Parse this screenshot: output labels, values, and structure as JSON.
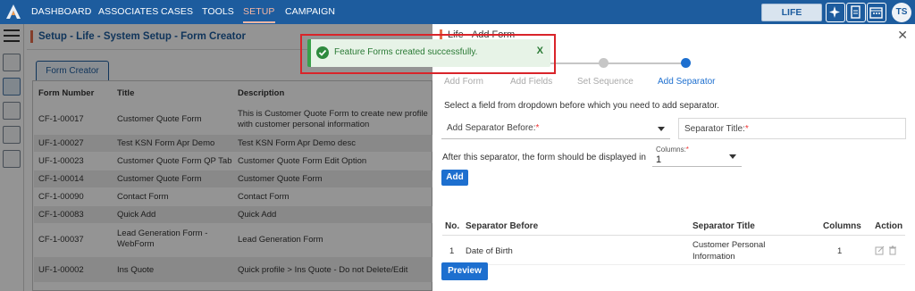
{
  "nav": {
    "items": [
      "DASHBOARD",
      "ASSOCIATES",
      "CASES",
      "TOOLS",
      "SETUP",
      "CAMPAIGN"
    ],
    "active": "SETUP",
    "line_label": "LIFE",
    "user_initials": "TS",
    "icons": [
      "sparkle-icon",
      "clipboard-icon",
      "calendar-icon"
    ]
  },
  "sidebar": {
    "icons": [
      "contact-card-icon",
      "contact-book-icon",
      "person-icon",
      "printer-icon",
      "form-icon"
    ]
  },
  "page": {
    "header": "Setup - Life - System Setup - Form Creator",
    "tab": "Form Creator",
    "columns": [
      "Form Number",
      "Title",
      "Description"
    ],
    "rows": [
      {
        "num": "CF-1-00017",
        "title": "Customer Quote Form",
        "desc": "This is Customer Quote Form to create new profile",
        "desc2": "with customer personal information"
      },
      {
        "num": "UF-1-00027",
        "title": "Test KSN Form Apr Demo",
        "desc": "Test KSN Form Apr Demo desc",
        "desc2": ""
      },
      {
        "num": "UF-1-00023",
        "title": "Customer Quote Form QP Tab",
        "desc": "Customer Quote Form Edit Option",
        "desc2": ""
      },
      {
        "num": "CF-1-00014",
        "title": "Customer Quote Form",
        "desc": "Customer Quote Form",
        "desc2": ""
      },
      {
        "num": "CF-1-00090",
        "title": "Contact Form",
        "desc": "Contact Form",
        "desc2": ""
      },
      {
        "num": "CF-1-00083",
        "title": "Quick Add",
        "desc": "Quick Add",
        "desc2": ""
      },
      {
        "num": "CF-1-00037",
        "title": "Lead Generation Form -",
        "title2": "WebForm",
        "desc": "Lead Generation Form",
        "desc2": ""
      },
      {
        "num": "UF-1-00002",
        "title": "Ins Quote",
        "desc": "Quick profile > Ins Quote - Do not Delete/Edit",
        "desc2": ""
      }
    ]
  },
  "modal": {
    "title": "Life - Add Form",
    "steps": [
      "Add Form",
      "Add Fields",
      "Set Sequence",
      "Add Separator"
    ],
    "active_step": 3,
    "instruction": "Select a field from dropdown before which you need to add separator.",
    "separator_before_label": "Add Separator Before:",
    "separator_title_label": "Separator Title:",
    "required_mark": "*",
    "after_text": "After this separator, the form should be displayed in",
    "columns_label": "Columns:",
    "columns_value": "1",
    "add_button": "Add",
    "table_headers": [
      "No.",
      "Separator Before",
      "Separator Title",
      "Columns",
      "Action"
    ],
    "table_rows": [
      {
        "no": "1",
        "before": "Date of Birth",
        "title": "Customer Personal",
        "title2": "Information",
        "columns": "1"
      }
    ],
    "preview_button": "Preview",
    "close": "✕"
  },
  "toast": {
    "message": "Feature Forms created successfully.",
    "close": "X",
    "accent": "#39a04a"
  },
  "colors": {
    "nav_bg": "#1d5c9e",
    "primary": "#1d6fcf",
    "header_accent": "#e46c4a",
    "highlight_frame": "#d9242a"
  }
}
